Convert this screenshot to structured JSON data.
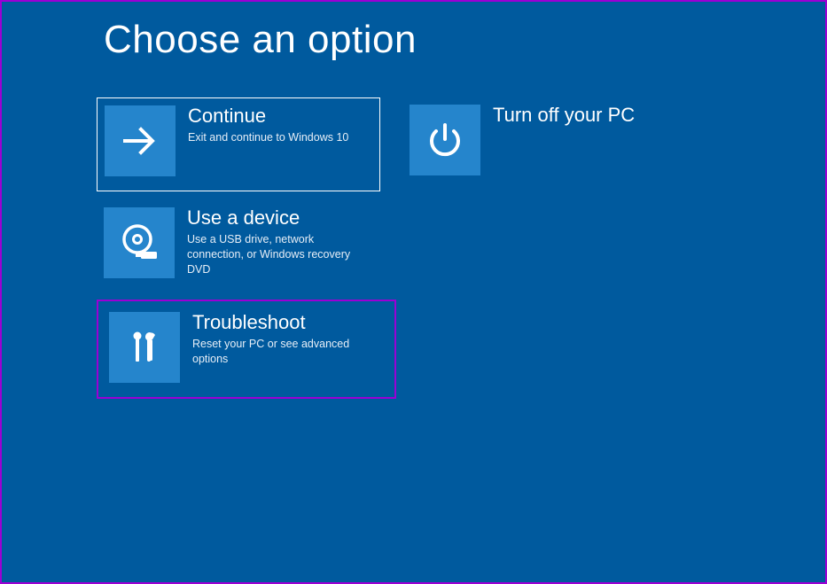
{
  "screen": {
    "title": "Choose an option"
  },
  "options": {
    "continue": {
      "label": "Continue",
      "desc": "Exit and continue to Windows 10"
    },
    "use_device": {
      "label": "Use a device",
      "desc": "Use a USB drive, network connection, or Windows recovery DVD"
    },
    "troubleshoot": {
      "label": "Troubleshoot",
      "desc": "Reset your PC or see advanced options"
    },
    "turn_off": {
      "label": "Turn off your PC",
      "desc": ""
    }
  },
  "colors": {
    "bg": "#005a9e",
    "tile": "#2585cc",
    "highlight": "#9b00d4"
  }
}
